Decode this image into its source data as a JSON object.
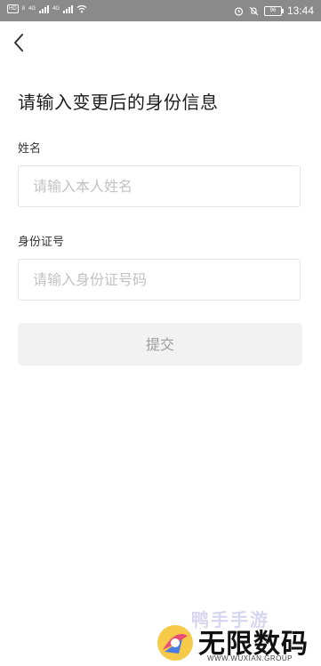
{
  "status_bar": {
    "left_chips": [
      "HD",
      "8"
    ],
    "network_1": "4G",
    "network_2": "4G",
    "battery": "96",
    "time": "13:44"
  },
  "nav": {
    "back_icon": "chevron-left-icon"
  },
  "form": {
    "heading": "请输入变更后的身份信息",
    "name_label": "姓名",
    "name_placeholder": "请输入本人姓名",
    "id_label": "身份证号",
    "id_placeholder": "请输入身份证号码",
    "submit_label": "提交"
  },
  "watermark": {
    "top_text": "鸭手手游",
    "main_text": "无限数码",
    "sub_text": "WWW.WUXIAN.GROUP"
  },
  "colors": {
    "status_bar": "#8a8a8a",
    "input_border": "#e5e5e5",
    "placeholder": "#c2c2c2",
    "button_bg": "#f2f2f2",
    "button_text": "#9d9d9d"
  }
}
